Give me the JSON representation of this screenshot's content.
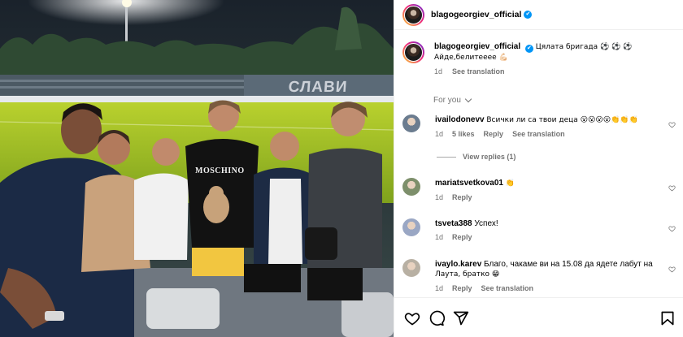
{
  "post": {
    "stand_lettering": "СЛАВИ",
    "shirt_lettering": "MOSCHINO"
  },
  "header": {
    "username": "blagogeorgiev_official",
    "verified_mark": "✔"
  },
  "caption": {
    "username": "blagogeorgiev_official",
    "text_line1": "Цялата бригада ⚽ ⚽ ⚽",
    "text_line2": "Айде,белитеeee 💪🏻",
    "time": "1d",
    "see_translation": "See translation"
  },
  "filter": {
    "label": "For you"
  },
  "comments": [
    {
      "username": "ivailodonevv",
      "text": "Всички ли са твои деца 😮😮😮😮👏👏👏",
      "time": "1d",
      "likes": "5 likes",
      "reply": "Reply",
      "see_translation": "See translation",
      "view_replies": "View replies (1)",
      "avatar_color": "#6b7c8f"
    },
    {
      "username": "mariatsvetkova01",
      "text": "👏",
      "time": "1d",
      "reply": "Reply",
      "avatar_color": "#7d8f6b"
    },
    {
      "username": "tsveta388",
      "text": "Успех!",
      "time": "1d",
      "reply": "Reply",
      "avatar_color": "#9aa7c4"
    },
    {
      "username": "ivaylo.karev",
      "text_line1": "Благо, чакаме ви на 15.08 да ядете лабут на",
      "text_line2": "Лаута, братко 😁",
      "time": "1d",
      "reply": "Reply",
      "see_translation": "See translation",
      "avatar_color": "#b8b0a3"
    }
  ],
  "actions": {
    "like": "heart-icon",
    "comment": "comment-icon",
    "share": "share-icon",
    "save": "bookmark-icon"
  },
  "colors": {
    "verified": "#0095f6",
    "secondary_text": "#737373",
    "border": "#efefef"
  }
}
